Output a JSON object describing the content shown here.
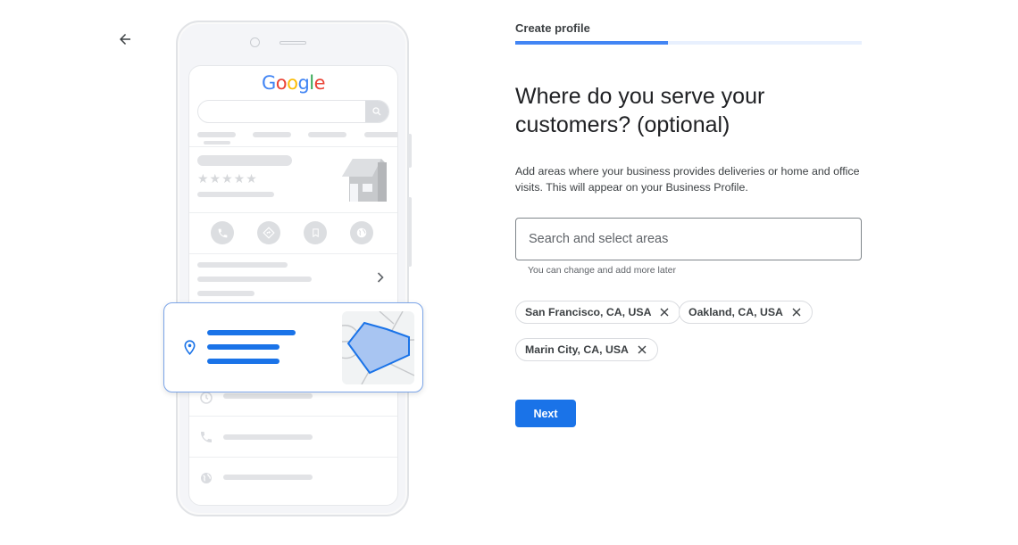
{
  "nav": {
    "back_icon": "arrow-back-icon"
  },
  "illustration": {
    "logo_letters": [
      {
        "ch": "G",
        "color": "#4285f4"
      },
      {
        "ch": "o",
        "color": "#ea4335"
      },
      {
        "ch": "o",
        "color": "#fbbc05"
      },
      {
        "ch": "g",
        "color": "#4285f4"
      },
      {
        "ch": "l",
        "color": "#34a853"
      },
      {
        "ch": "e",
        "color": "#ea4335"
      }
    ],
    "action_icons": [
      "phone-icon",
      "directions-icon",
      "bookmark-icon",
      "globe-icon"
    ],
    "detail_icons": [
      "clock-icon",
      "phone-icon",
      "globe-icon"
    ],
    "card_icon": "location-pin-icon"
  },
  "header": {
    "step_label": "Create profile",
    "progress_percent": 44,
    "accent_color": "#4285f4"
  },
  "main": {
    "title": "Where do you serve your customers? (optional)",
    "description": "Add areas where your business provides deliveries or home and office visits. This will appear on your Business Profile.",
    "search": {
      "placeholder": "Search and select areas",
      "value": "",
      "helper": "You can change and add more later"
    },
    "chips": [
      {
        "label": "San Francisco, CA, USA"
      },
      {
        "label": "Oakland, CA, USA"
      },
      {
        "label": "Marin City, CA, USA"
      }
    ],
    "next_label": "Next",
    "button_color": "#1a73e8"
  }
}
